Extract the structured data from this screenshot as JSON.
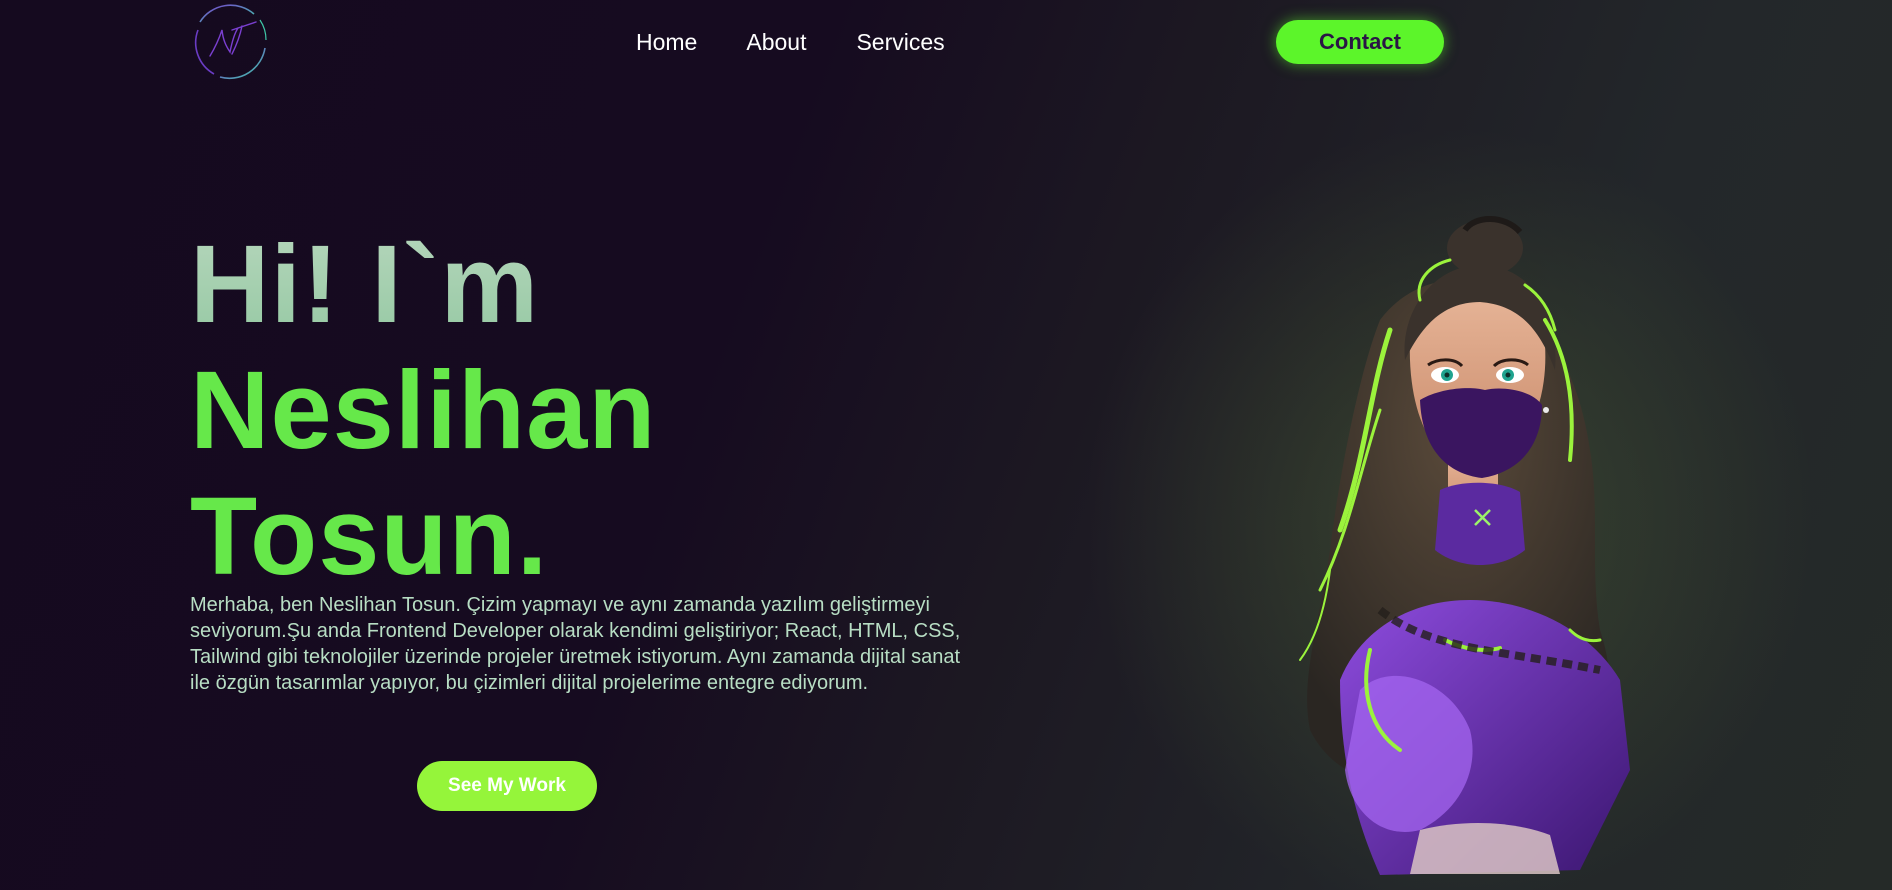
{
  "header": {
    "logo_icon": "nt-signature-logo-icon",
    "nav": {
      "home": "Home",
      "about": "About",
      "services": "Services"
    },
    "contact_label": "Contact"
  },
  "hero": {
    "greeting": "Hi! I`m",
    "first_name": "Neslihan",
    "last_name": "Tosun.",
    "description": "Merhaba, ben Neslihan Tosun. Çizim yapmayı ve aynı zamanda yazılım geliştirmeyi seviyorum.Şu anda Frontend Developer olarak kendimi geliştiriyor; React, HTML, CSS, Tailwind gibi teknolojiler üzerinde projeler üretmek istiyorum. Aynı zamanda dijital sanat ile özgün tasarımlar yapıyor, bu çizimleri dijital projelerime entegre ediyorum.",
    "cta_label": "See My Work",
    "illustration": "masked-girl-illustration"
  },
  "colors": {
    "accent_green": "#5cf52a",
    "name_green": "#66e84a",
    "greeting_mint": "#a7d0b0",
    "button_lime": "#95f53a",
    "background_dark": "#150a1f",
    "mask_purple": "#3a1560"
  }
}
